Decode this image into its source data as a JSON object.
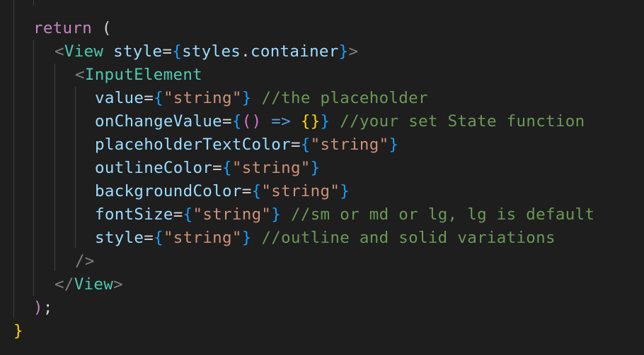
{
  "code": {
    "return_kw": "return",
    "open_paren": " (",
    "view_tag": "View",
    "style_attr": "style",
    "styles_obj": "styles",
    "container_prop": "container",
    "input_tag": "InputElement",
    "props": {
      "value": "value",
      "onChangeValue": "onChangeValue",
      "placeholderTextColor": "placeholderTextColor",
      "outlineColor": "outlineColor",
      "backgroundColor": "backgroundColor",
      "fontSize": "fontSize",
      "style": "style"
    },
    "string_literal": "\"string\"",
    "arrow_fn_parens": "()",
    "arrow_op": "=>",
    "empty_body": "{}",
    "comments": {
      "value": "//the placeholder",
      "onChangeValue": "//your set State function",
      "fontSize": "//sm or md or lg, lg is default",
      "style": "//outline and solid variations"
    },
    "self_close": "/>",
    "close_view_tag": "View",
    "close_paren": ");",
    "close_brace": "}"
  }
}
